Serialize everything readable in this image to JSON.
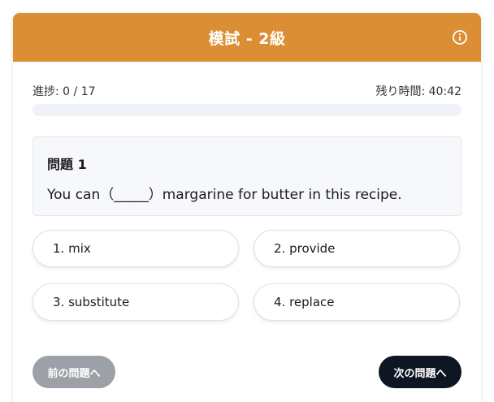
{
  "header": {
    "title": "模試 - 2級",
    "info_icon": "info-circle-icon",
    "color": "#db8e33"
  },
  "status": {
    "progress_text": "進捗: 0 / 17",
    "progress_value": 0,
    "timer_text": "残り時間: 40:42"
  },
  "question": {
    "title": "問題 1",
    "text": "You can（_____）margarine for butter in this recipe."
  },
  "options": [
    {
      "label": "1. mix"
    },
    {
      "label": "2. provide"
    },
    {
      "label": "3. substitute"
    },
    {
      "label": "4. replace"
    }
  ],
  "nav": {
    "prev_label": "前の問題へ",
    "next_label": "次の問題へ"
  }
}
